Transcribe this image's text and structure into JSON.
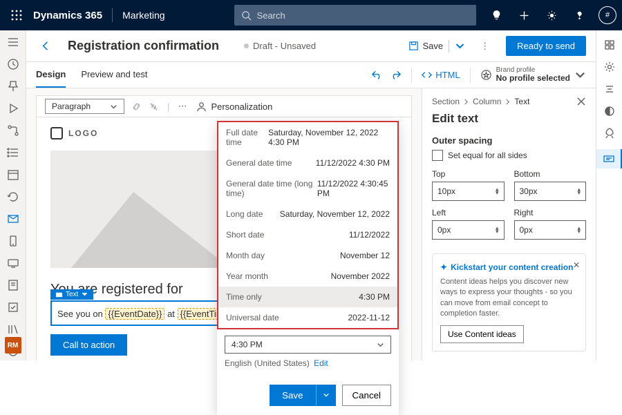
{
  "brand": "Dynamics 365",
  "appname": "Marketing",
  "search": {
    "placeholder": "Search"
  },
  "avatar": "#",
  "page": {
    "title": "Registration confirmation",
    "status": "Draft - Unsaved"
  },
  "cmds": {
    "save": "Save",
    "ready": "Ready to send"
  },
  "tabs": {
    "design": "Design",
    "preview": "Preview and test",
    "html": "HTML"
  },
  "brandprofile": {
    "label": "Brand profile",
    "value": "No profile selected"
  },
  "toolbar": {
    "paragraph": "Paragraph",
    "personalization": "Personalization"
  },
  "email": {
    "logo": "LOGO",
    "headline": "You are registered for",
    "tag": "Text",
    "line_prefix": "See you on ",
    "token1": "{{EventDate}}",
    "mid": " at ",
    "token2": "{{EventTime}}",
    "suffix": ".",
    "cta": "Call to action"
  },
  "datepopup": {
    "rows": [
      {
        "label": "Full date time",
        "value": "Saturday, November 12, 2022 4:30 PM"
      },
      {
        "label": "General date time",
        "value": "11/12/2022 4:30 PM"
      },
      {
        "label": "General date time (long time)",
        "value": "11/12/2022 4:30:45 PM"
      },
      {
        "label": "Long date",
        "value": "Saturday, November 12, 2022"
      },
      {
        "label": "Short date",
        "value": "11/12/2022"
      },
      {
        "label": "Month day",
        "value": "November 12"
      },
      {
        "label": "Year month",
        "value": "November 2022"
      },
      {
        "label": "Time only",
        "value": "4:30 PM"
      },
      {
        "label": "Universal date",
        "value": "2022-11-12"
      }
    ],
    "input": "4:30 PM",
    "locale": "English (United States)",
    "edit": "Edit",
    "save": "Save",
    "cancel": "Cancel"
  },
  "panel": {
    "crumb1": "Section",
    "crumb2": "Column",
    "crumb3": "Text",
    "title": "Edit text",
    "outerspacing": "Outer spacing",
    "setequal": "Set equal for all sides",
    "top": "Top",
    "bottom": "Bottom",
    "left": "Left",
    "right": "Right",
    "topval": "10px",
    "bottomval": "30px",
    "leftval": "0px",
    "rightval": "0px",
    "callout_title": "Kickstart your content creation",
    "callout_body": "Content ideas helps you discover new ways to express your thoughts - so you can move from email concept to completion faster.",
    "callout_btn": "Use Content ideas"
  },
  "rmbadge": "RM"
}
